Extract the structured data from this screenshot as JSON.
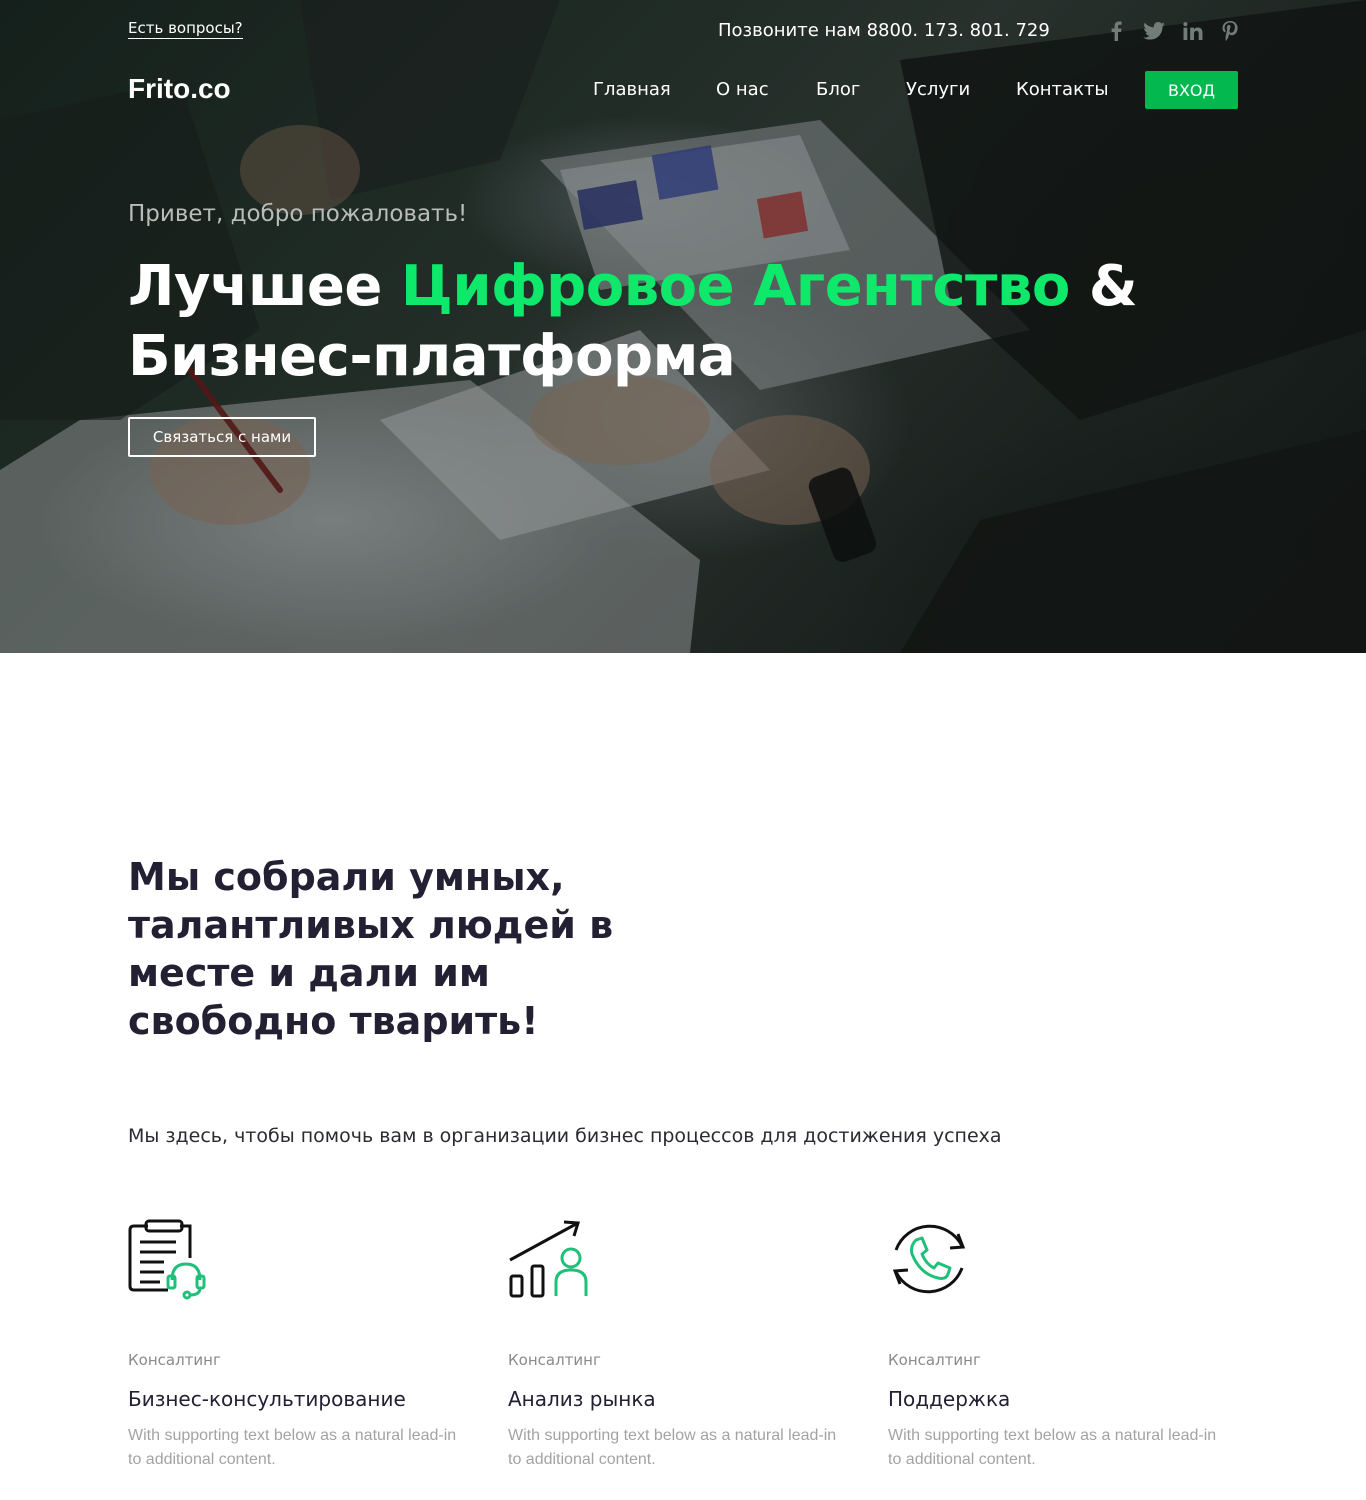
{
  "topbar": {
    "question_link": "Есть вопросы?",
    "phone": "Позвоните нам 8800. 173. 801. 729",
    "social": [
      {
        "icon": "facebook-icon",
        "glyph": "f"
      },
      {
        "icon": "twitter-icon",
        "glyph": "t"
      },
      {
        "icon": "linkedin-icon",
        "glyph": "in"
      },
      {
        "icon": "pinterest-icon",
        "glyph": "p"
      }
    ]
  },
  "header": {
    "logo": "Frito.co",
    "nav": [
      "Главная",
      "О нас",
      "Блог",
      "Услуги",
      "Контакты"
    ],
    "login": "ВХОД"
  },
  "hero": {
    "greeting": "Привет, добро пожаловать!",
    "title_part1": "Лучшее ",
    "title_accent": "Цифровое Агентство",
    "title_part2": " & Бизнес-платформа",
    "cta": "Связаться с нами"
  },
  "about": {
    "heading": "Мы собрали умных, талантливых людей в месте и дали им свободно тварить!",
    "subtitle": "Мы здесь, чтобы помочь вам в организации бизнес процессов для достижения успеха"
  },
  "services": [
    {
      "icon": "consulting-clipboard-headset-icon",
      "category": "Консалтинг",
      "title": "Бизнес-консультирование",
      "text": "With supporting text below as a natural lead-in to additional content."
    },
    {
      "icon": "market-analysis-chart-icon",
      "category": "Консалтинг",
      "title": "Анализ рынка",
      "text": "With supporting text below as a natural lead-in to additional content."
    },
    {
      "icon": "support-phone-icon",
      "category": "Консалтинг",
      "title": "Поддержка",
      "text": "With supporting text below as a natural lead-in to additional content."
    }
  ],
  "colors": {
    "accent": "#0ee86b",
    "button_green": "#03b84f",
    "icon_green": "#1fc07a",
    "heading": "#232033",
    "muted": "#a3a3a3"
  }
}
